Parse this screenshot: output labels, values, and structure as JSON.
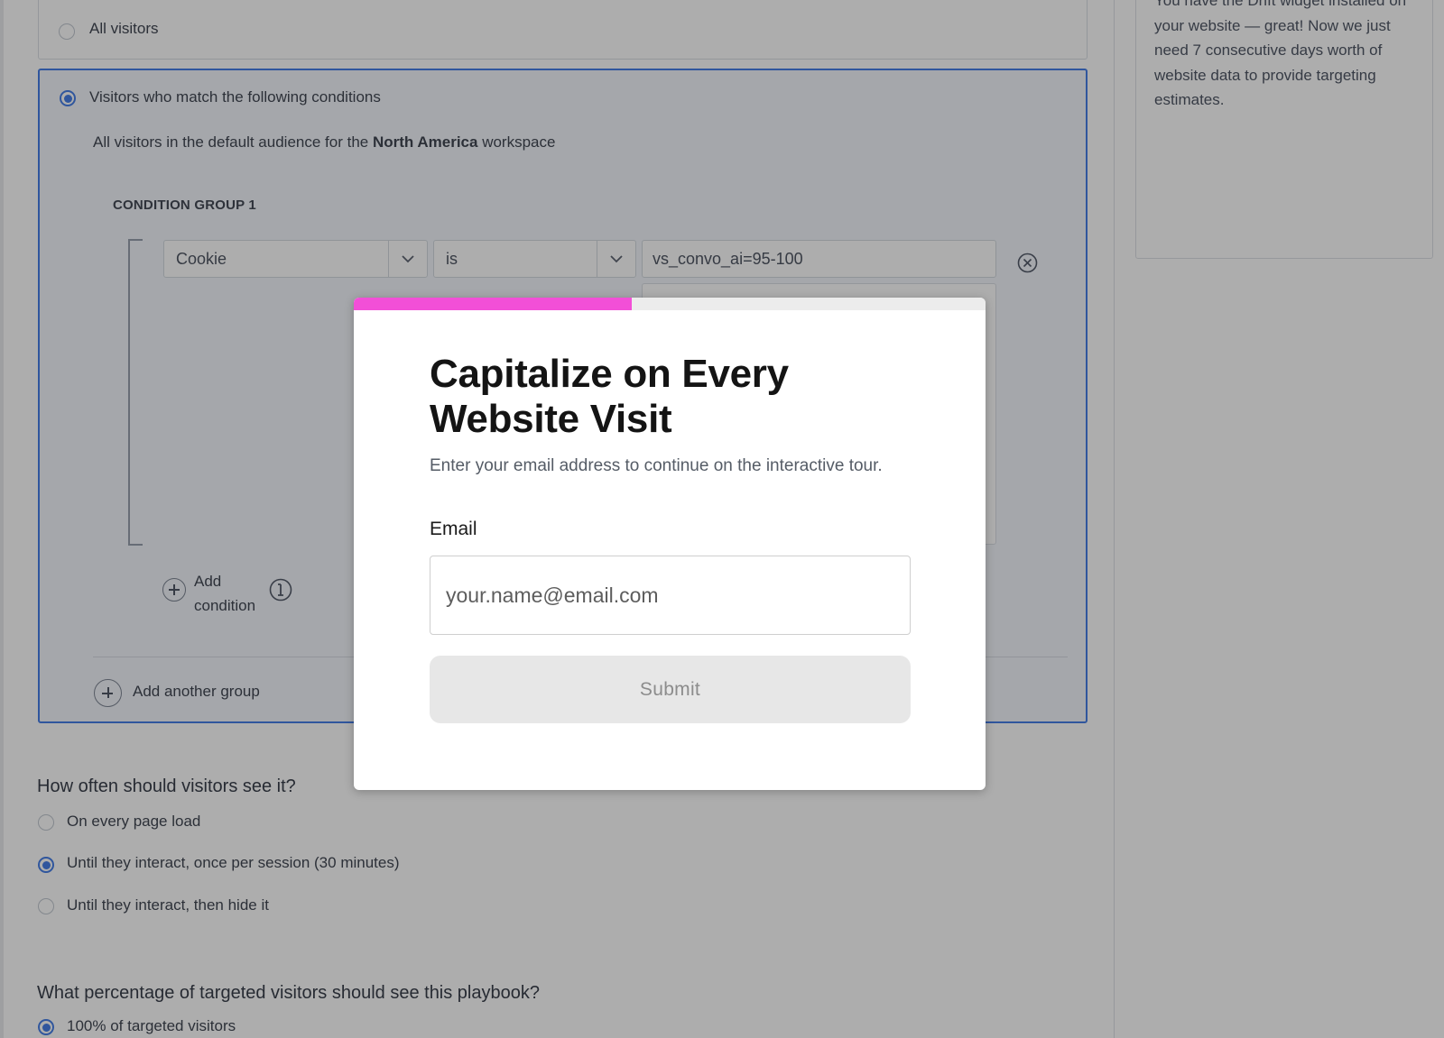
{
  "audience": {
    "all_visitors_label": "All visitors",
    "match_conditions_label": "Visitors who match the following conditions",
    "default_audience_prefix": "All visitors in the default audience for the ",
    "default_audience_workspace": "North America",
    "default_audience_suffix": " workspace",
    "condition_group_title": "CONDITION GROUP 1",
    "condition": {
      "attribute": "Cookie",
      "operator": "is",
      "value": "vs_convo_ai=95-100"
    },
    "add_condition_line1": "Add",
    "add_condition_line2": "condition",
    "add_another_group": "Add another group"
  },
  "frequency": {
    "question": "How often should visitors see it?",
    "options": [
      {
        "label": "On every page load",
        "selected": false
      },
      {
        "label": "Until they interact, once per session (30 minutes)",
        "selected": true
      },
      {
        "label": "Until they interact, then hide it",
        "selected": false
      }
    ]
  },
  "percentage": {
    "question": "What percentage of targeted visitors should see this playbook?",
    "options": [
      {
        "label": "100% of targeted visitors",
        "selected": true
      }
    ]
  },
  "rail": {
    "text": "You have the Drift widget installed on your website — great! Now we just need 7 consecutive days worth of website data to provide targeting estimates."
  },
  "modal": {
    "progress_fraction": 0.44,
    "progress_color": "#f24fd7",
    "title": "Capitalize on Every Website Visit",
    "subtitle": "Enter your email address to continue on the interactive tour.",
    "email_label": "Email",
    "email_placeholder": "your.name@email.com",
    "submit_label": "Submit"
  }
}
